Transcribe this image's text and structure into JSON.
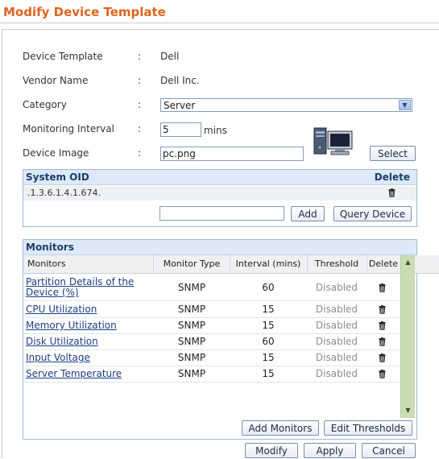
{
  "page_title": "Modify Device Template",
  "form": {
    "template_label": "Device Template",
    "template_value": "Dell",
    "vendor_label": "Vendor Name",
    "vendor_value": "Dell Inc.",
    "category_label": "Category",
    "category_value": "Server",
    "interval_label": "Monitoring Interval",
    "interval_value": "5",
    "interval_unit": "mins",
    "image_label": "Device Image",
    "image_value": "pc.png",
    "select_button": "Select",
    "colon": ":"
  },
  "oid_section": {
    "header": "System OID",
    "delete_header": "Delete",
    "oids": [
      ".1.3.6.1.4.1.674."
    ],
    "new_oid_value": "",
    "add_button": "Add",
    "query_button": "Query Device"
  },
  "monitors_section": {
    "header": "Monitors",
    "columns": [
      "Monitors",
      "Monitor Type",
      "Interval (mins)",
      "Threshold",
      "Delete"
    ],
    "rows": [
      {
        "name": "Partition Details of the Device (%)",
        "type": "SNMP",
        "interval": "60",
        "threshold": "Disabled"
      },
      {
        "name": "CPU Utilization",
        "type": "SNMP",
        "interval": "15",
        "threshold": "Disabled"
      },
      {
        "name": "Memory Utilization",
        "type": "SNMP",
        "interval": "15",
        "threshold": "Disabled"
      },
      {
        "name": "Disk Utilization",
        "type": "SNMP",
        "interval": "60",
        "threshold": "Disabled"
      },
      {
        "name": "Input Voltage",
        "type": "SNMP",
        "interval": "15",
        "threshold": "Disabled"
      },
      {
        "name": "Server Temperature",
        "type": "SNMP",
        "interval": "15",
        "threshold": "Disabled"
      }
    ],
    "add_monitors_button": "Add Monitors",
    "edit_thresholds_button": "Edit Thresholds"
  },
  "footer": {
    "modify_button": "Modify",
    "apply_button": "Apply",
    "cancel_button": "Cancel"
  },
  "icons": {
    "device_image": "desktop-computer-icon",
    "delete": "trash-icon",
    "dropdown": "chevron-down-icon"
  },
  "colors": {
    "title": "#e0641d",
    "box_header": "#dde9f6",
    "link": "#1d3f86",
    "scrollbar": "#c9dcb4"
  }
}
